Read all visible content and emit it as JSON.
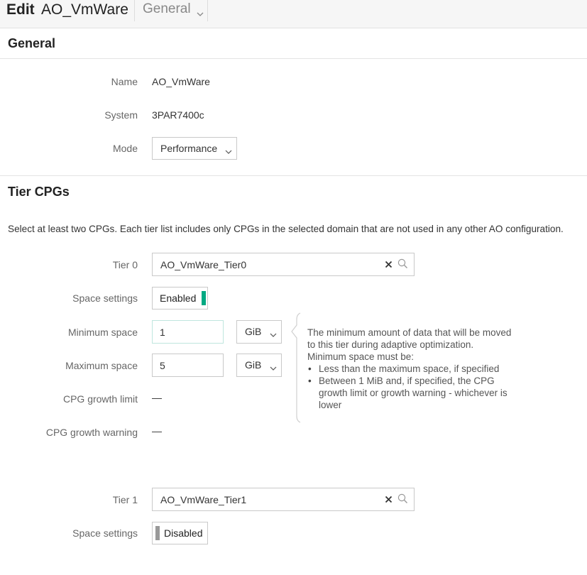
{
  "header": {
    "edit_label": "Edit",
    "object_name": "AO_VmWare",
    "section_selector": "General"
  },
  "general": {
    "title": "General",
    "name_label": "Name",
    "name_value": "AO_VmWare",
    "system_label": "System",
    "system_value": "3PAR7400c",
    "mode_label": "Mode",
    "mode_value": "Performance"
  },
  "tier_cpgs": {
    "title": "Tier CPGs",
    "description": "Select at least two CPGs. Each tier list includes only CPGs in the selected domain that are not used in any other AO configuration.",
    "tier0": {
      "label": "Tier 0",
      "value": "AO_VmWare_Tier0",
      "space_settings_label": "Space settings",
      "space_settings_value": "Enabled",
      "min_space_label": "Minimum space",
      "min_space_value": "1",
      "min_space_unit": "GiB",
      "max_space_label": "Maximum space",
      "max_space_value": "5",
      "max_space_unit": "GiB",
      "growth_limit_label": "CPG growth limit",
      "growth_limit_value": "—",
      "growth_warning_label": "CPG growth warning",
      "growth_warning_value": "—"
    },
    "help": {
      "intro": "The minimum amount of data that will be moved to this tier during adaptive optimization. Minimum space must be:",
      "bullets": [
        "Less than the maximum space, if specified",
        "Between 1 MiB and, if specified, the CPG growth limit or growth warning - whichever is lower"
      ]
    },
    "tier1": {
      "label": "Tier 1",
      "value": "AO_VmWare_Tier1",
      "space_settings_label": "Space settings",
      "space_settings_value": "Disabled"
    }
  },
  "colors": {
    "toggle_enabled": "#01a982",
    "toggle_disabled": "#999999",
    "input_focus_border": "#bfe6de"
  },
  "icons": {
    "clear": "close-icon",
    "search": "search-icon",
    "dropdown": "chevron-down-icon"
  }
}
